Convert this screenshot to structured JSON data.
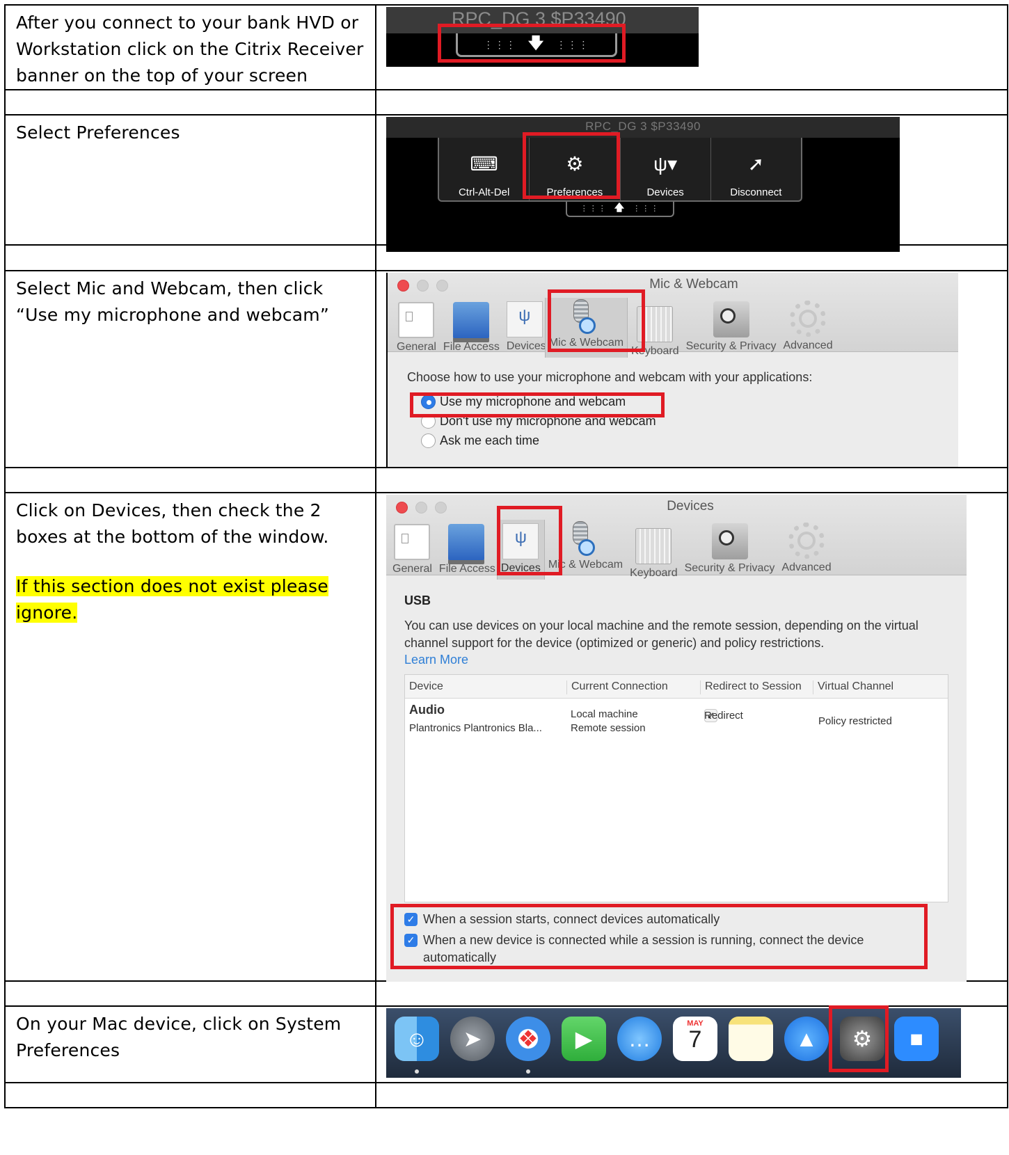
{
  "steps": [
    {
      "text": "After you connect to your bank HVD or Workstation  click on the Citrix Receiver banner on the top of your screen"
    },
    {
      "text": "Select Preferences"
    },
    {
      "text": "Select Mic and Webcam, then click “Use my microphone  and webcam”"
    },
    {
      "text": "Click on Devices, then check the 2 boxes at the bottom of the window.",
      "note": "If this section does not exist please ignore."
    },
    {
      "text": "On your Mac device, click on System Preferences"
    }
  ],
  "shot1": {
    "title": "RPC_DG 3 $P33490"
  },
  "shot2": {
    "title": "RPC_DG 3 $P33490",
    "buttons": [
      {
        "label": "Ctrl-Alt-Del",
        "icon": "ctrl-alt-del-icon"
      },
      {
        "label": "Preferences",
        "icon": "gears-icon"
      },
      {
        "label": "Devices",
        "icon": "usb-icon"
      },
      {
        "label": "Disconnect",
        "icon": "plug-icon"
      }
    ]
  },
  "prefs_tabs": [
    "General",
    "File Access",
    "Devices",
    "Mic & Webcam",
    "Keyboard",
    "Security & Privacy",
    "Advanced"
  ],
  "shot3": {
    "title": "Mic & Webcam",
    "prompt": "Choose how to use your microphone and webcam with your applications:",
    "options": [
      "Use my microphone and webcam",
      "Don't use my microphone and webcam",
      "Ask me each time"
    ],
    "selected": 0
  },
  "shot4": {
    "title": "Devices",
    "section": "USB",
    "description": "You can use devices on your local machine and the remote session, depending on the virtual channel support for the device (optimized or generic) and policy restrictions.",
    "learn_more": "Learn More",
    "columns": [
      "Device",
      "Current Connection",
      "Redirect to Session",
      "Virtual Channel"
    ],
    "device_name": "Audio",
    "device_sub": "Plantronics Plantronics Bla...",
    "connection_1": "Local machine",
    "connection_2": "Remote session",
    "redirect": "Redirect",
    "virtual_channel": "Policy restricted",
    "checkbox_1": "When a session starts, connect devices automatically",
    "checkbox_2": "When a new device is connected while a session is running, connect the device automatically"
  },
  "shot5": {
    "calendar_month": "MAY",
    "calendar_day": "7",
    "dock_icons": [
      "finder-icon",
      "launchpad-icon",
      "safari-icon",
      "facetime-icon",
      "messages-icon",
      "calendar-icon",
      "notes-icon",
      "app-store-icon",
      "system-preferences-icon",
      "zoom-icon"
    ]
  },
  "colors": {
    "highlight": "#ffff00",
    "callout_red": "#e01b24",
    "selection_blue": "#2e7ce7"
  }
}
